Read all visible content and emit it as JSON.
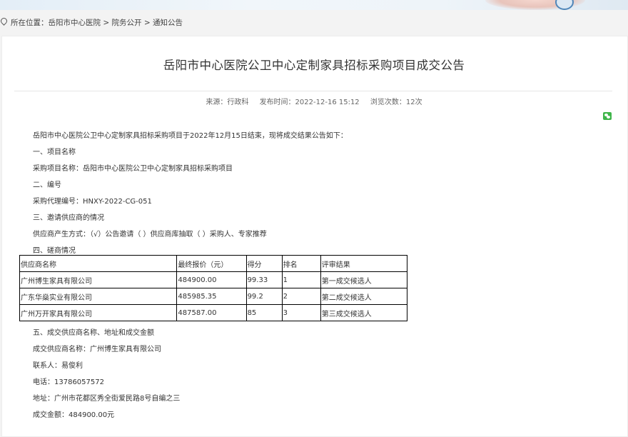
{
  "breadcrumb": {
    "label": "所在位置：",
    "items": [
      "岳阳市中心医院",
      "院务公开",
      "通知公告"
    ],
    "separator": ">"
  },
  "article": {
    "title": "岳阳市中心医院公卫中心定制家具招标采购项目成交公告",
    "meta": {
      "source": "来源：行政科",
      "publish_time": "发布时间：2022-12-16 15:12",
      "views": "浏览次数：12次"
    },
    "paragraphs": [
      "岳阳市中心医院公卫中心定制家具招标采购项目于2022年12月15日结束，现将成交结果公告如下：",
      "一、项目名称",
      "采购项目名称：岳阳市中心医院公卫中心定制家具招标采购项目",
      "二、编号",
      "采购代理编号：HNXY-2022-CG-051",
      "三、邀请供应商的情况",
      "供应商产生方式：（√）公告邀请（ ）供应商库抽取（ ）采购人、专家推荐",
      "四、磋商情况"
    ],
    "table": {
      "headers": [
        "供应商名称",
        "最终报价（元）",
        "得分",
        "排名",
        "评审结果"
      ],
      "rows": [
        [
          "广州博生家具有限公司",
          "484900.00",
          "99.33",
          "1",
          "第一成交候选人"
        ],
        [
          "广东华燊实业有限公司",
          "485985.35",
          "99.2",
          "2",
          "第二成交候选人"
        ],
        [
          "广州万开家具有限公司",
          "487587.00",
          "85",
          "3",
          "第三成交候选人"
        ]
      ]
    },
    "after_table": [
      "五、成交供应商名称、地址和成交金额",
      "成交供应商名称：广州博生家具有限公司",
      "联系人：易俊利",
      "电话：13786057572",
      "地址：广州市花都区秀全街爱民路8号自编之三",
      "成交金额：484900.00元"
    ]
  },
  "icons": {
    "location": "location-pin-icon",
    "share": "wechat-share-icon"
  },
  "colors": {
    "wechat": "#3fb54a",
    "table_border": "#000000"
  }
}
